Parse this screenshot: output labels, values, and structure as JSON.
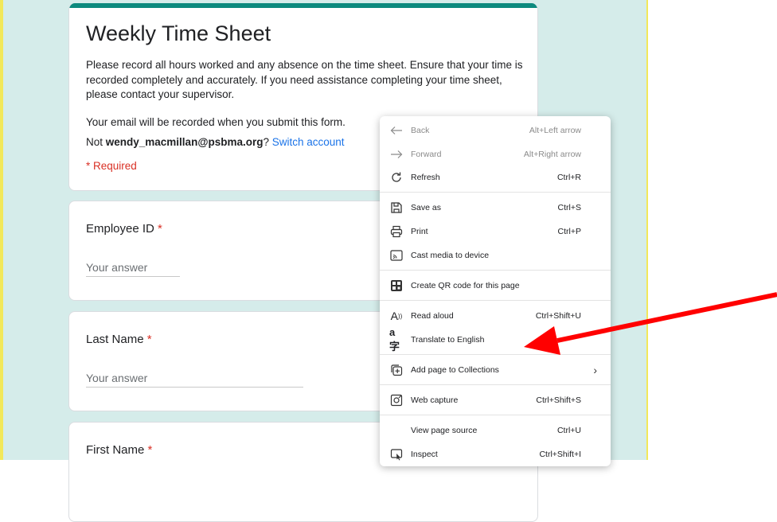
{
  "form": {
    "title": "Weekly Time Sheet",
    "description": "Please record all hours worked and any absence on the time sheet.  Ensure that your time is recorded completely and accurately. If you need assistance completing your time sheet, please contact your supervisor.",
    "email_note": "Your email will be recorded when you submit this form.",
    "account_prefix": "Not ",
    "account_email": "wendy_macmillan@psbma.org",
    "account_suffix": "? ",
    "switch_account": "Switch account",
    "required_note": "* Required",
    "questions": [
      {
        "label": "Employee ID",
        "required_mark": "*",
        "placeholder": "Your answer"
      },
      {
        "label": "Last Name",
        "required_mark": "*",
        "placeholder": "Your answer"
      },
      {
        "label": "First Name",
        "required_mark": "*"
      }
    ]
  },
  "context_menu": {
    "items": [
      {
        "label": "Back",
        "shortcut": "Alt+Left arrow",
        "icon": "back-arrow-icon",
        "enabled": false
      },
      {
        "label": "Forward",
        "shortcut": "Alt+Right arrow",
        "icon": "forward-arrow-icon",
        "enabled": false
      },
      {
        "label": "Refresh",
        "shortcut": "Ctrl+R",
        "icon": "refresh-icon",
        "enabled": true
      },
      {
        "label": "Save as",
        "shortcut": "Ctrl+S",
        "icon": "save-icon",
        "enabled": true
      },
      {
        "label": "Print",
        "shortcut": "Ctrl+P",
        "icon": "print-icon",
        "enabled": true
      },
      {
        "label": "Cast media to device",
        "shortcut": "",
        "icon": "cast-icon",
        "enabled": true
      },
      {
        "label": "Create QR code for this page",
        "shortcut": "",
        "icon": "qr-code-icon",
        "enabled": true
      },
      {
        "label": "Read aloud",
        "shortcut": "Ctrl+Shift+U",
        "icon": "read-aloud-icon",
        "enabled": true
      },
      {
        "label": "Translate to English",
        "shortcut": "",
        "icon": "translate-icon",
        "enabled": true
      },
      {
        "label": "Add page to Collections",
        "shortcut": "",
        "icon": "collections-icon",
        "enabled": true,
        "submenu": true
      },
      {
        "label": "Web capture",
        "shortcut": "Ctrl+Shift+S",
        "icon": "web-capture-icon",
        "enabled": true
      },
      {
        "label": "View page source",
        "shortcut": "Ctrl+U",
        "icon": "",
        "enabled": true
      },
      {
        "label": "Inspect",
        "shortcut": "Ctrl+Shift+I",
        "icon": "inspect-icon",
        "enabled": true
      }
    ]
  },
  "colors": {
    "page_background": "#d5ecea",
    "form_accent": "#0c8a7e",
    "required_red": "#d93025",
    "link_blue": "#1a73e8",
    "annotation_arrow": "#ff0000"
  }
}
